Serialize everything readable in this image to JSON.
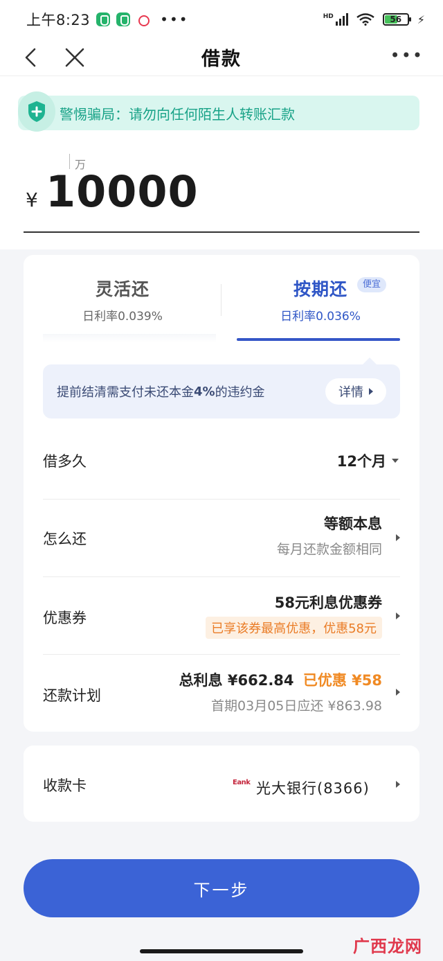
{
  "status_bar": {
    "time": "上午8:23",
    "more": "•••",
    "network": "HD",
    "battery_level": "56",
    "icons": [
      "shield-app-icon",
      "shield-app-icon",
      "red-app-icon",
      "signal-icon",
      "wifi-icon",
      "battery-icon",
      "charging-bolt-icon"
    ]
  },
  "nav": {
    "title": "借款",
    "more": "•••",
    "icons": [
      "back-arrow-icon",
      "close-icon",
      "more-icon"
    ]
  },
  "warning": {
    "text": "警惕骗局：请勿向任何陌生人转账汇款",
    "icon": "shield-plus-icon"
  },
  "amount": {
    "unit_hint": "万",
    "currency": "¥",
    "value": "10000"
  },
  "tabs": [
    {
      "title": "灵活还",
      "rate": "日利率0.039%",
      "selected": false
    },
    {
      "title": "按期还",
      "rate": "日利率0.036%",
      "selected": true,
      "badge": "便宜"
    }
  ],
  "notice": {
    "text_prefix": "提前结清需支付未还本金",
    "text_bold": "4%",
    "text_suffix": "的违约金",
    "detail_label": "详情"
  },
  "rows": {
    "term": {
      "label": "借多久",
      "value": "12个月"
    },
    "method": {
      "label": "怎么还",
      "value": "等额本息",
      "sub": "每月还款金额相同"
    },
    "coupon": {
      "label": "优惠券",
      "value": "58元利息优惠券",
      "tag": "已享该券最高优惠，优惠58元"
    },
    "plan": {
      "label": "还款计划",
      "interest_label": "总利息 ¥662.84",
      "discount_label": "已优惠 ¥58",
      "sub": "首期03月05日应还 ¥863.98"
    }
  },
  "receive": {
    "label": "收款卡",
    "bank_logo": "Eank",
    "bank_name": "光大银行(8366)"
  },
  "next_button": "下一步",
  "watermark": "广西龙网",
  "colors": {
    "primary": "#3b63d6",
    "tab_active": "#2f56c6",
    "warning_text": "#18a287",
    "warning_bg": "#d9f6ef",
    "discount_orange": "#f08a24",
    "coupon_tag_bg": "#fdf0e2"
  }
}
